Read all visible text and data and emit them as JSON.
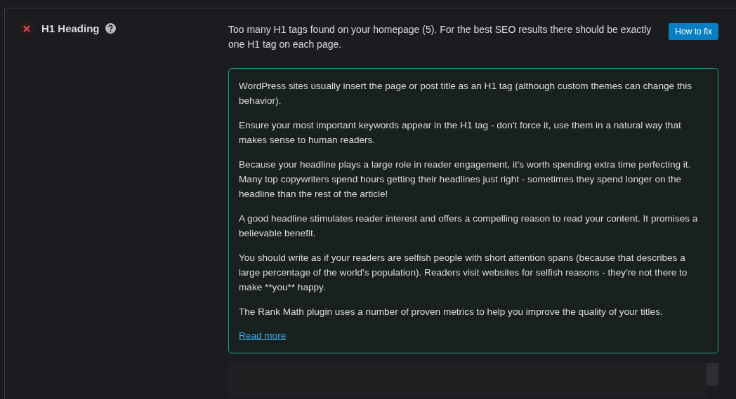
{
  "check": {
    "title": "H1 Heading",
    "passed": false,
    "message": "Too many H1 tags found on your homepage (5). For the best SEO results there should be exactly one H1 tag on each page.",
    "button": "How to fix"
  },
  "help": {
    "paragraphs": [
      "WordPress sites usually insert the page or post title as an H1 tag (although custom themes can change this behavior).",
      "Ensure your most important keywords appear in the H1 tag - don't force it, use them in a natural way that makes sense to human readers.",
      "Because your headline plays a large role in reader engagement, it's worth spending extra time perfecting it. Many top copywriters spend hours getting their headlines just right - sometimes they spend longer on the headline than the rest of the article!",
      "A good headline stimulates reader interest and offers a compelling reason to read your content. It promises a believable benefit.",
      "You should write as if your readers are selfish people with short attention spans (because that describes a large percentage of the world's population). Readers visit websites for selfish reasons - they're not there to make **you** happy.",
      "The Rank Math plugin uses a number of proven metrics to help you improve the quality of your titles."
    ],
    "link": "Read more"
  }
}
